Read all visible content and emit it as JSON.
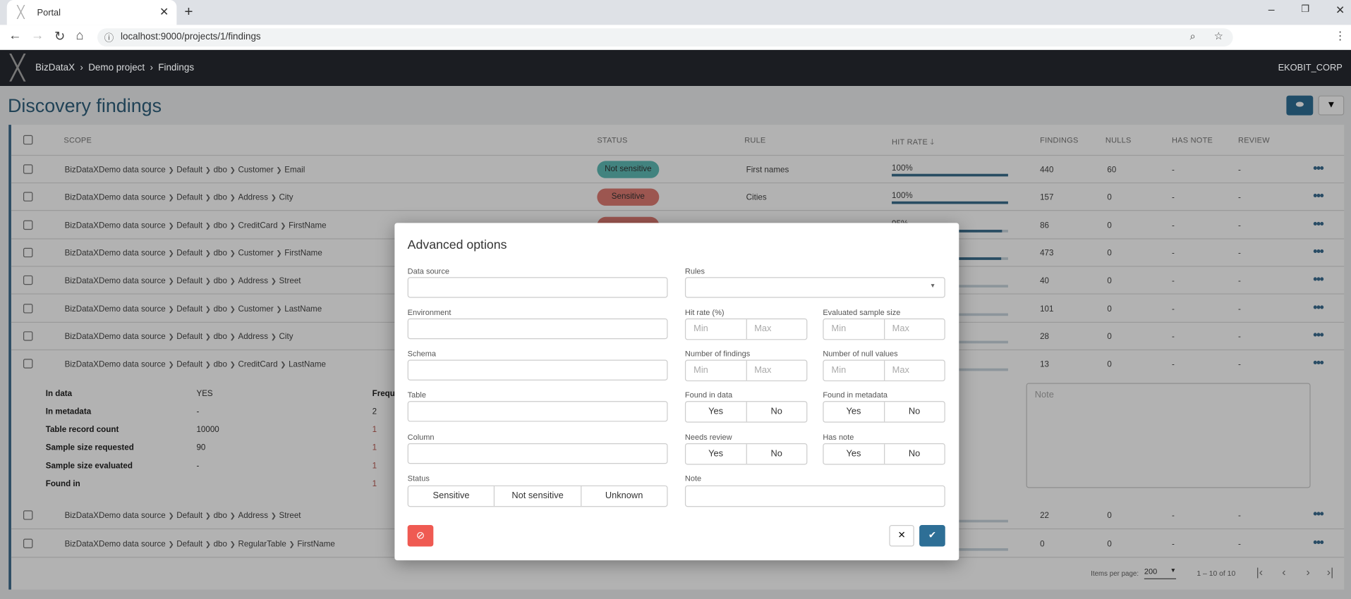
{
  "browser": {
    "tab_title": "Portal",
    "url": "localhost:9000/projects/1/findings"
  },
  "header": {
    "breadcrumb": [
      "BizDataX",
      "Demo project",
      "Findings"
    ],
    "org": "EKOBIT_CORP"
  },
  "page": {
    "title": "Discovery findings"
  },
  "colors": {
    "accent": "#2e6f96",
    "sensitive": "#e07b73",
    "not_sensitive": "#5fbcb7",
    "danger": "#ef5a52"
  },
  "table": {
    "columns": [
      "SCOPE",
      "STATUS",
      "RULE",
      "HIT RATE",
      "FINDINGS",
      "NULLS",
      "HAS NOTE",
      "REVIEW"
    ],
    "rows": [
      {
        "scope": [
          "BizDataXDemo data source",
          "Default",
          "dbo",
          "Customer",
          "Email"
        ],
        "status": "Not sensitive",
        "status_kind": "not_sensitive",
        "rule": "First names",
        "hit_rate_label": "100%",
        "hit_rate": 100,
        "findings": "440",
        "nulls": "60",
        "has_note": "-",
        "review": "-"
      },
      {
        "scope": [
          "BizDataXDemo data source",
          "Default",
          "dbo",
          "Address",
          "City"
        ],
        "status": "Sensitive",
        "status_kind": "sensitive",
        "rule": "Cities",
        "hit_rate_label": "100%",
        "hit_rate": 100,
        "findings": "157",
        "nulls": "0",
        "has_note": "-",
        "review": "-"
      },
      {
        "scope": [
          "BizDataXDemo data source",
          "Default",
          "dbo",
          "CreditCard",
          "FirstName"
        ],
        "status": "",
        "status_kind": "sensitive",
        "rule": "",
        "hit_rate_label": "95%",
        "hit_rate": 95,
        "findings": "86",
        "nulls": "0",
        "has_note": "-",
        "review": "-"
      },
      {
        "scope": [
          "BizDataXDemo data source",
          "Default",
          "dbo",
          "Customer",
          "FirstName"
        ],
        "status": "",
        "status_kind": "",
        "rule": "",
        "hit_rate_label": "",
        "hit_rate": 94,
        "findings": "473",
        "nulls": "0",
        "has_note": "-",
        "review": "-"
      },
      {
        "scope": [
          "BizDataXDemo data source",
          "Default",
          "dbo",
          "Address",
          "Street"
        ],
        "status": "",
        "status_kind": "",
        "rule": "",
        "hit_rate_label": "",
        "hit_rate": 0,
        "findings": "40",
        "nulls": "0",
        "has_note": "-",
        "review": "-"
      },
      {
        "scope": [
          "BizDataXDemo data source",
          "Default",
          "dbo",
          "Customer",
          "LastName"
        ],
        "status": "",
        "status_kind": "",
        "rule": "",
        "hit_rate_label": "",
        "hit_rate": 0,
        "findings": "101",
        "nulls": "0",
        "has_note": "-",
        "review": "-"
      },
      {
        "scope": [
          "BizDataXDemo data source",
          "Default",
          "dbo",
          "Address",
          "City"
        ],
        "status": "",
        "status_kind": "",
        "rule": "",
        "hit_rate_label": "",
        "hit_rate": 0,
        "findings": "28",
        "nulls": "0",
        "has_note": "-",
        "review": "-"
      },
      {
        "scope": [
          "BizDataXDemo data source",
          "Default",
          "dbo",
          "CreditCard",
          "LastName"
        ],
        "status": "",
        "status_kind": "",
        "rule": "",
        "hit_rate_label": "",
        "hit_rate": 0,
        "findings": "13",
        "nulls": "0",
        "has_note": "-",
        "review": "-"
      },
      {
        "scope": [
          "BizDataXDemo data source",
          "Default",
          "dbo",
          "Address",
          "Street"
        ],
        "status": "",
        "status_kind": "",
        "rule": "",
        "hit_rate_label": "",
        "hit_rate": 0,
        "findings": "22",
        "nulls": "0",
        "has_note": "-",
        "review": "-"
      },
      {
        "scope": [
          "BizDataXDemo data source",
          "Default",
          "dbo",
          "RegularTable",
          "FirstName"
        ],
        "status": "",
        "status_kind": "",
        "rule": "",
        "hit_rate_label": "",
        "hit_rate": 0,
        "findings": "0",
        "nulls": "0",
        "has_note": "-",
        "review": "-"
      }
    ],
    "detail": {
      "items": [
        {
          "label": "In data",
          "value": "YES"
        },
        {
          "label": "In metadata",
          "value": "-"
        },
        {
          "label": "Table record count",
          "value": "10000"
        },
        {
          "label": "Sample size requested",
          "value": "90"
        },
        {
          "label": "Sample size evaluated",
          "value": "-"
        },
        {
          "label": "Found in",
          "value": ""
        }
      ],
      "freq_header": "Frequ",
      "freq_values": [
        "2",
        "1",
        "1",
        "1",
        "1"
      ],
      "note_placeholder": "Note"
    },
    "pagination": {
      "items_per_page_label": "Items per page:",
      "items_per_page": "200",
      "range": "1 – 10 of 10"
    }
  },
  "modal": {
    "title": "Advanced options",
    "data_source": "Data source",
    "environment": "Environment",
    "schema": "Schema",
    "table": "Table",
    "column": "Column",
    "status": {
      "label": "Status",
      "options": [
        "Sensitive",
        "Not sensitive",
        "Unknown"
      ]
    },
    "rules": "Rules",
    "hit_rate": "Hit rate (%)",
    "sample_size": "Evaluated sample size",
    "num_findings": "Number of findings",
    "num_nulls": "Number of null values",
    "min": "Min",
    "max": "Max",
    "found_in_data": "Found in data",
    "found_in_metadata": "Found in metadata",
    "needs_review": "Needs review",
    "has_note": "Has note",
    "yes": "Yes",
    "no": "No",
    "note": "Note"
  }
}
